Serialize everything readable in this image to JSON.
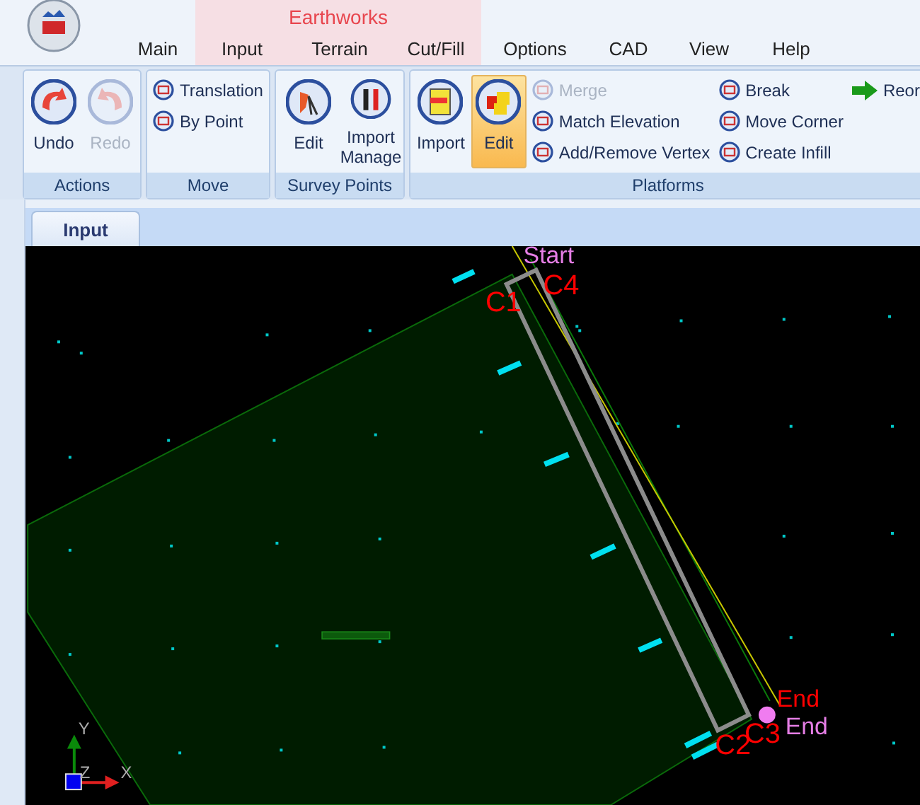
{
  "ribbon_tabs_left": [
    {
      "label": "Main"
    }
  ],
  "context_group": {
    "label": "Earthworks",
    "tabs": [
      {
        "label": "Input"
      },
      {
        "label": "Terrain"
      },
      {
        "label": "Cut/Fill"
      }
    ]
  },
  "ribbon_tabs_right": [
    {
      "label": "Options"
    },
    {
      "label": "CAD"
    },
    {
      "label": "View"
    },
    {
      "label": "Help"
    }
  ],
  "ribbon_groups": [
    {
      "label": "Actions",
      "large": [
        {
          "label": "Undo",
          "disabled": false,
          "selected": false
        },
        {
          "label": "Redo",
          "disabled": true,
          "selected": false
        }
      ]
    },
    {
      "label": "Move",
      "small_columns": [
        [
          {
            "label": "Translation",
            "disabled": false
          },
          {
            "label": "By Point",
            "disabled": false
          }
        ]
      ]
    },
    {
      "label": "Survey Points",
      "large": [
        {
          "label": "Edit",
          "disabled": false,
          "selected": false
        },
        {
          "label": "Import Manage",
          "disabled": false,
          "selected": false
        }
      ]
    },
    {
      "label": "Platforms",
      "large": [
        {
          "label": "Import",
          "disabled": false,
          "selected": false
        },
        {
          "label": "Edit",
          "disabled": false,
          "selected": true
        }
      ],
      "small_columns": [
        [
          {
            "label": "Merge",
            "disabled": true
          },
          {
            "label": "Match Elevation",
            "disabled": false
          },
          {
            "label": "Add/Remove Vertex",
            "disabled": false
          }
        ],
        [
          {
            "label": "Break",
            "disabled": false
          },
          {
            "label": "Move Corner",
            "disabled": false
          },
          {
            "label": "Create Infill",
            "disabled": false
          }
        ],
        [
          {
            "label": "Reor",
            "disabled": false
          }
        ]
      ]
    }
  ],
  "document_tabs": [
    {
      "label": "Input",
      "selected": true
    }
  ],
  "canvas": {
    "labels": [
      {
        "text": "Start",
        "color": "#e67ee6"
      },
      {
        "text": "C4",
        "color": "#ff0000"
      },
      {
        "text": "C1",
        "color": "#ff0000"
      },
      {
        "text": "End",
        "color": "#ff0000"
      },
      {
        "text": "End",
        "color": "#e67ee6"
      },
      {
        "text": "C3",
        "color": "#ff0000"
      },
      {
        "text": "C2",
        "color": "#ff0000"
      }
    ],
    "axis_labels": [
      "Y",
      "Z",
      "X"
    ]
  }
}
